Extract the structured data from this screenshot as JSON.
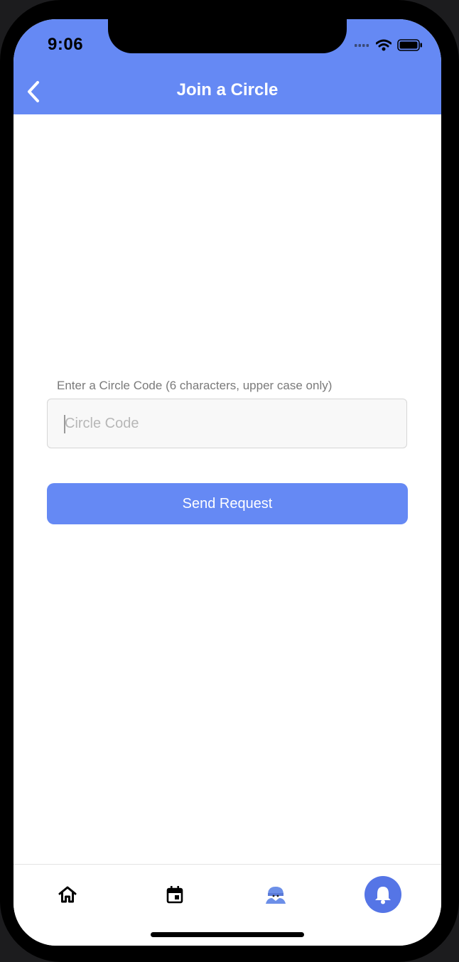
{
  "status": {
    "time": "9:06"
  },
  "header": {
    "title": "Join a Circle"
  },
  "form": {
    "label": "Enter a Circle Code (6 characters, upper case only)",
    "input_value": "",
    "input_placeholder": "Circle Code",
    "button_label": "Send Request"
  },
  "tabbar": {
    "icons": [
      "home-icon",
      "calendar-icon",
      "people-icon",
      "bell-icon"
    ]
  },
  "colors": {
    "accent": "#6589f4",
    "active_tab_bg": "#5575e6"
  }
}
